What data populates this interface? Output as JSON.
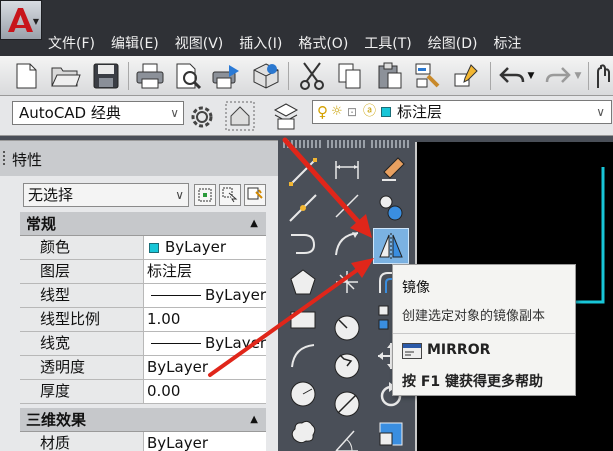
{
  "menu": {
    "items": [
      {
        "label": "文件(F)",
        "name": "menu-file"
      },
      {
        "label": "编辑(E)",
        "name": "menu-edit"
      },
      {
        "label": "视图(V)",
        "name": "menu-view"
      },
      {
        "label": "插入(I)",
        "name": "menu-insert"
      },
      {
        "label": "格式(O)",
        "name": "menu-format"
      },
      {
        "label": "工具(T)",
        "name": "menu-tools"
      },
      {
        "label": "绘图(D)",
        "name": "menu-draw"
      },
      {
        "label": "标注",
        "name": "menu-dimension"
      }
    ]
  },
  "workspace": {
    "value": "AutoCAD 经典"
  },
  "layer": {
    "current": "标注层"
  },
  "properties": {
    "title": "特性",
    "selection": "无选择",
    "sections": [
      {
        "name": "常规",
        "rows": [
          {
            "label": "颜色",
            "value": "ByLayer"
          },
          {
            "label": "图层",
            "value": "标注层"
          },
          {
            "label": "线型",
            "value": "ByLayer"
          },
          {
            "label": "线型比例",
            "value": "1.00"
          },
          {
            "label": "线宽",
            "value": "ByLayer"
          },
          {
            "label": "透明度",
            "value": "ByLayer"
          },
          {
            "label": "厚度",
            "value": "0.00"
          }
        ]
      },
      {
        "name": "三维效果",
        "rows": [
          {
            "label": "材质",
            "value": "ByLayer"
          }
        ]
      }
    ]
  },
  "tooltip": {
    "title": "镜像",
    "description": "创建选定对象的镜像副本",
    "command": "MIRROR",
    "help": "按 F1 键获得更多帮助"
  },
  "colors": {
    "annotation_arrow": "#e0261a",
    "layer_color": "#18c6d8",
    "drawing_bg": "#000000"
  }
}
